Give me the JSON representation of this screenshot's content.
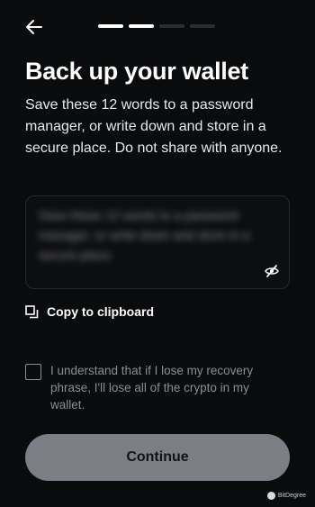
{
  "header": {
    "back_icon": "arrow-left-icon",
    "progress": {
      "total_steps": 4,
      "completed_steps": 2
    }
  },
  "title": "Back up your wallet",
  "subtitle": "Save these 12 words to a password manager, or write down and store in a secure place. Do not share with anyone.",
  "phrase_box": {
    "hidden_text": "Save these 12 words to a password manager, or write down and store in a secure place.",
    "toggle_icon": "eye-off-icon"
  },
  "copy": {
    "label": "Copy to clipboard",
    "icon": "copy-icon"
  },
  "agreement": {
    "checked": false,
    "text": "I understand that if I lose my recovery phrase, I'll lose all of the crypto in my wallet."
  },
  "continue_button": {
    "label": "Continue",
    "enabled": false
  },
  "watermark": {
    "text": "BitDegree"
  },
  "colors": {
    "background": "#0a0b0d",
    "text_primary": "#ffffff",
    "text_muted": "#8a8d93",
    "button_disabled": "#7b7e84",
    "progress_active": "#ffffff",
    "progress_inactive": "#2b2d31"
  }
}
